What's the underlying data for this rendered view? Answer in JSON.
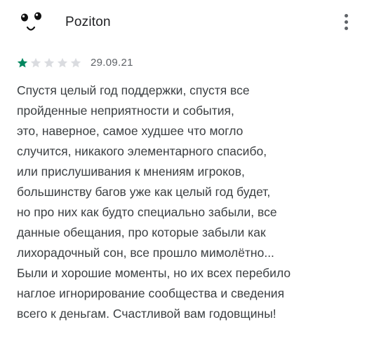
{
  "review": {
    "author": "Poziton",
    "rating": 1,
    "rating_max": 5,
    "date": "29.09.21",
    "colors": {
      "star_filled": "#01875f",
      "star_empty": "#dadce0",
      "text": "#3c4043"
    },
    "icons": {
      "avatar": "smiley-face-avatar",
      "menu": "more-vert-icon",
      "star": "star-icon"
    },
    "text_lines": [
      "Спустя целый год поддержки, спустя все",
      "пройденные неприятности и события,",
      "это, наверное, самое худшее что могло",
      "случится, никакого элементарного спасибо,",
      "или прислушивания к мнениям игроков,",
      "большинству багов уже как целый год будет,",
      "но про них как будто специально забыли, все",
      "данные обещания, про которые забыли как",
      "лихорадочный сон, все прошло мимолётно...",
      "Были и хорошие моменты, но их всех перебило",
      "наглое игнорирование сообщества и сведения",
      "всего к деньгам. Счастливой вам годовщины!"
    ]
  }
}
